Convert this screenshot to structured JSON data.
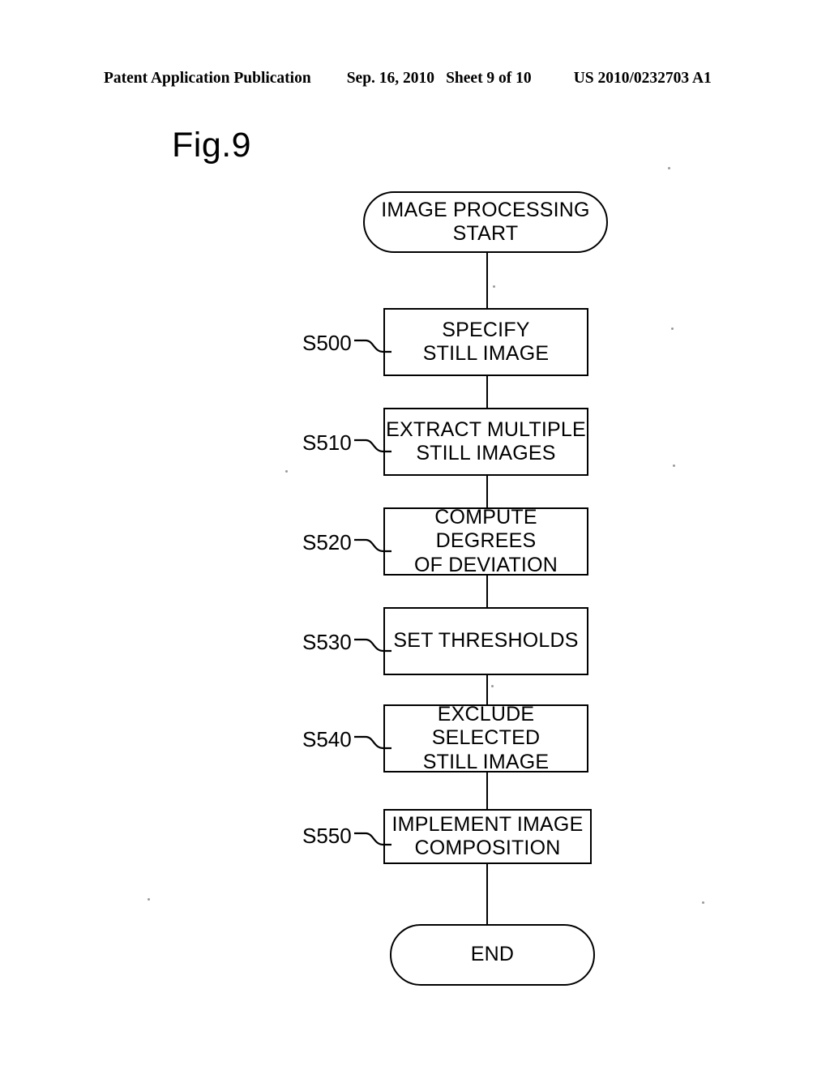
{
  "header": {
    "publication": "Patent Application Publication",
    "date": "Sep. 16, 2010",
    "sheet": "Sheet 9 of 10",
    "patent_number": "US 2010/0232703 A1"
  },
  "figure": {
    "label": "Fig.9"
  },
  "flowchart": {
    "start": {
      "text": "IMAGE PROCESSING\nSTART"
    },
    "end": {
      "text": "END"
    },
    "steps": [
      {
        "id": "S500",
        "text": "SPECIFY\nSTILL IMAGE"
      },
      {
        "id": "S510",
        "text": "EXTRACT MULTIPLE\nSTILL IMAGES"
      },
      {
        "id": "S520",
        "text": "COMPUTE DEGREES\nOF DEVIATION"
      },
      {
        "id": "S530",
        "text": "SET THRESHOLDS"
      },
      {
        "id": "S540",
        "text": "EXCLUDE SELECTED\nSTILL IMAGE"
      },
      {
        "id": "S550",
        "text": "IMPLEMENT IMAGE\nCOMPOSITION"
      }
    ]
  },
  "colors": {
    "ink": "#000000",
    "paper": "#ffffff"
  }
}
